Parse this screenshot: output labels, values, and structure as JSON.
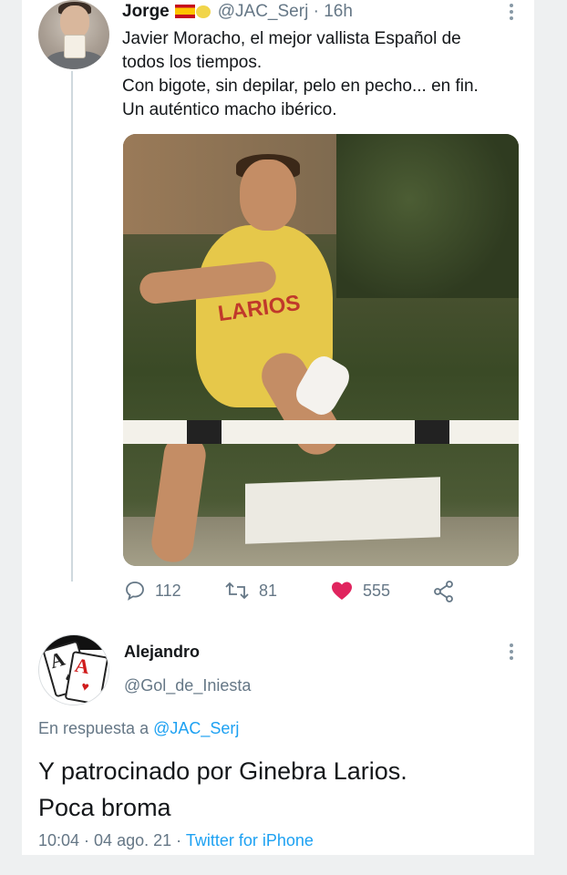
{
  "tweet": {
    "author_name": "Jorge",
    "handle": "@JAC_Serj",
    "separator": "·",
    "time": "16h",
    "text_lines": [
      "Javier Moracho, el mejor vallista Español de",
      "todos los tiempos.",
      "Con bigote, sin depilar, pelo en pecho... en fin.",
      "Un auténtico macho ibérico."
    ],
    "photo_logo": "LARIOS",
    "actions": {
      "replies": "112",
      "retweets": "81",
      "likes": "555"
    },
    "colors": {
      "like": "#e0245e",
      "icon": "#657786"
    }
  },
  "reply": {
    "author_name": "Alejandro",
    "handle": "@Gol_de_Iniesta",
    "replying_prefix": "En respuesta a",
    "replying_to": "@JAC_Serj",
    "text_lines": [
      "Y patrocinado por Ginebra Larios.",
      "Poca broma"
    ],
    "timestamp": "10:04 · 04 ago. 21",
    "separator": "·",
    "source_app": "Twitter for iPhone",
    "colors": {
      "link": "#1da1f2"
    }
  }
}
